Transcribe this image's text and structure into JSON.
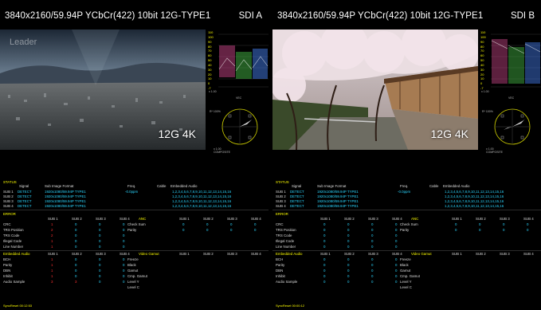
{
  "panels": [
    {
      "id": "a",
      "format": "3840x2160/59.94P YCbCr(422) 10bit 12G-TYPE1",
      "sdi": "SDI A",
      "picture_label": "12G 4K",
      "watermark": "Leader",
      "wfm_scale": [
        "110",
        "100",
        "90",
        "80",
        "70",
        "60",
        "50",
        "40",
        "30",
        "20",
        "10",
        "0",
        "-7"
      ],
      "wfm_unit": "x 1.00",
      "vec_title": "VEC",
      "vec_top_left": "R* 100%",
      "vec_bottom": "x 1.00",
      "vec_bottom2": "COMPOSITE",
      "status": {
        "title": "STATUS",
        "headers": [
          "Signal",
          "Sub Image Format",
          "Freq.",
          "Cable",
          "Embedded Audio"
        ],
        "rows": [
          {
            "sub": "SUB 1",
            "signal": "DETECT",
            "format": "1920x1080/59.94P TYPE1",
            "freq": "-0.0ppm",
            "audio": "1,2,3,4,5,6,7,8,9,10,11,12,13,14,15,16"
          },
          {
            "sub": "SUB 2",
            "signal": "DETECT",
            "format": "1920x1080/59.94P TYPE1",
            "freq": "",
            "audio": "1,2,3,4,5,6,7,8,9,10,11,12,13,14,15,16"
          },
          {
            "sub": "SUB 3",
            "signal": "DETECT",
            "format": "1920x1080/59.94P TYPE1",
            "freq": "",
            "audio": "1,2,3,4,5,6,7,8,9,10,11,12,13,14,15,16"
          },
          {
            "sub": "SUB 4",
            "signal": "DETECT",
            "format": "1920x1080/59.94P TYPE1",
            "freq": "",
            "audio": "1,2,3,4,5,6,7,8,9,10,11,12,13,14,15,16"
          }
        ]
      },
      "error": {
        "title": "ERROR",
        "sub_headers": [
          "SUB 1",
          "SUB 2",
          "SUB 3",
          "SUB 4"
        ],
        "left_rows": [
          {
            "label": "CRC",
            "vals": [
              "1",
              "0",
              "0",
              "0"
            ],
            "red": [
              true,
              false,
              false,
              false
            ]
          },
          {
            "label": "TRS Position",
            "vals": [
              "2",
              "0",
              "0",
              "0"
            ],
            "red": [
              true,
              false,
              false,
              false
            ]
          },
          {
            "label": "TRS Code",
            "vals": [
              "2",
              "0",
              "0",
              "0"
            ],
            "red": [
              true,
              false,
              false,
              false
            ]
          },
          {
            "label": "Illegal Code",
            "vals": [
              "1",
              "0",
              "0",
              "0"
            ],
            "red": [
              true,
              false,
              false,
              false
            ]
          },
          {
            "label": "Line Number",
            "vals": [
              "1",
              "0",
              "0",
              "0"
            ],
            "red": [
              true,
              false,
              false,
              false
            ]
          }
        ],
        "anc_title": "ANC",
        "anc_rows": [
          {
            "label": "Check Sum",
            "vals": [
              "0",
              "0",
              "0",
              "0"
            ]
          },
          {
            "label": "Parity",
            "vals": [
              "0",
              "0",
              "0",
              "0"
            ]
          }
        ],
        "audio_title": "Embedded Audio",
        "audio_rows": [
          {
            "label": "BCH",
            "vals": [
              "1",
              "0",
              "0",
              "0"
            ],
            "red": [
              true,
              false,
              false,
              false
            ]
          },
          {
            "label": "Parity",
            "vals": [
              "1",
              "0",
              "0",
              "0"
            ],
            "red": [
              true,
              false,
              false,
              false
            ]
          },
          {
            "label": "DBN",
            "vals": [
              "1",
              "0",
              "0",
              "0"
            ],
            "red": [
              true,
              false,
              false,
              false
            ]
          },
          {
            "label": "Inhibit",
            "vals": [
              "1",
              "0",
              "0",
              "0"
            ],
            "red": [
              true,
              false,
              false,
              false
            ]
          },
          {
            "label": "Audio Sample",
            "vals": [
              "3",
              "3",
              "0",
              "0"
            ],
            "red": [
              true,
              true,
              false,
              false
            ]
          }
        ],
        "gamut_title": "Video Gamut",
        "gamut_rows": [
          "Freeze",
          "Black",
          "Gamut",
          "Cmp. Gamut",
          "Level Y",
          "Level C"
        ]
      },
      "footer": "SyncReset 00:12:53"
    },
    {
      "id": "b",
      "format": "3840x2160/59.94P YCbCr(422) 10bit 12G-TYPE1",
      "sdi": "SDI B",
      "picture_label": "12G 4K",
      "watermark": "",
      "wfm_scale": [
        "110",
        "100",
        "90",
        "80",
        "70",
        "60",
        "50",
        "40",
        "30",
        "20",
        "10",
        "0",
        "-7"
      ],
      "wfm_unit": "x 1.00",
      "vec_title": "VEC",
      "vec_top_left": "R* 100%",
      "vec_bottom": "x 1.00",
      "vec_bottom2": "COMPOSITE",
      "status": {
        "title": "STATUS",
        "headers": [
          "Signal",
          "Sub Image Format",
          "Freq.",
          "Cable",
          "Embedded Audio"
        ],
        "rows": [
          {
            "sub": "SUB 1",
            "signal": "DETECT",
            "format": "1920x1080/59.94P TYPE1",
            "freq": "-0.0ppm",
            "audio": "1,2,3,4,5,6,7,8,9,10,11,12,13,14,15,16"
          },
          {
            "sub": "SUB 2",
            "signal": "DETECT",
            "format": "1920x1080/59.94P TYPE1",
            "freq": "",
            "audio": "1,2,3,4,5,6,7,8,9,10,11,12,13,14,15,16"
          },
          {
            "sub": "SUB 3",
            "signal": "DETECT",
            "format": "1920x1080/59.94P TYPE1",
            "freq": "",
            "audio": "1,2,3,4,5,6,7,8,9,10,11,12,13,14,15,16"
          },
          {
            "sub": "SUB 4",
            "signal": "DETECT",
            "format": "1920x1080/59.94P TYPE1",
            "freq": "",
            "audio": "1,2,3,4,5,6,7,8,9,10,11,12,13,14,15,16"
          }
        ]
      },
      "error": {
        "title": "ERROR",
        "sub_headers": [
          "SUB 1",
          "SUB 2",
          "SUB 3",
          "SUB 4"
        ],
        "left_rows": [
          {
            "label": "CRC",
            "vals": [
              "0",
              "0",
              "0",
              "0"
            ],
            "red": [
              false,
              false,
              false,
              false
            ]
          },
          {
            "label": "TRS Position",
            "vals": [
              "0",
              "0",
              "0",
              "0"
            ],
            "red": [
              false,
              false,
              false,
              false
            ]
          },
          {
            "label": "TRS Code",
            "vals": [
              "0",
              "0",
              "0",
              "0"
            ],
            "red": [
              false,
              false,
              false,
              false
            ]
          },
          {
            "label": "Illegal Code",
            "vals": [
              "0",
              "0",
              "0",
              "0"
            ],
            "red": [
              false,
              false,
              false,
              false
            ]
          },
          {
            "label": "Line Number",
            "vals": [
              "0",
              "0",
              "0",
              "0"
            ],
            "red": [
              false,
              false,
              false,
              false
            ]
          }
        ],
        "anc_title": "ANC",
        "anc_rows": [
          {
            "label": "Check Sum",
            "vals": [
              "0",
              "0",
              "0",
              "0"
            ]
          },
          {
            "label": "Parity",
            "vals": [
              "0",
              "0",
              "0",
              "0"
            ]
          }
        ],
        "audio_title": "Embedded Audio",
        "audio_rows": [
          {
            "label": "BCH",
            "vals": [
              "0",
              "0",
              "0",
              "0"
            ],
            "red": [
              false,
              false,
              false,
              false
            ]
          },
          {
            "label": "Parity",
            "vals": [
              "0",
              "0",
              "0",
              "0"
            ],
            "red": [
              false,
              false,
              false,
              false
            ]
          },
          {
            "label": "DBN",
            "vals": [
              "0",
              "0",
              "0",
              "0"
            ],
            "red": [
              false,
              false,
              false,
              false
            ]
          },
          {
            "label": "Inhibit",
            "vals": [
              "0",
              "0",
              "0",
              "0"
            ],
            "red": [
              false,
              false,
              false,
              false
            ]
          },
          {
            "label": "Audio Sample",
            "vals": [
              "0",
              "0",
              "0",
              "0"
            ],
            "red": [
              false,
              false,
              false,
              false
            ]
          }
        ],
        "gamut_title": "Video Gamut",
        "gamut_rows": [
          "Freeze",
          "Black",
          "Gamut",
          "Cmp. Gamut",
          "Level Y",
          "Level C"
        ]
      },
      "footer": "SyncReset 00:00:12"
    }
  ],
  "colors": {
    "label": "#ffff00",
    "value": "#2bd6ff",
    "error": "#ff3030",
    "text": "#dddddd",
    "scope": "#dddd00"
  }
}
